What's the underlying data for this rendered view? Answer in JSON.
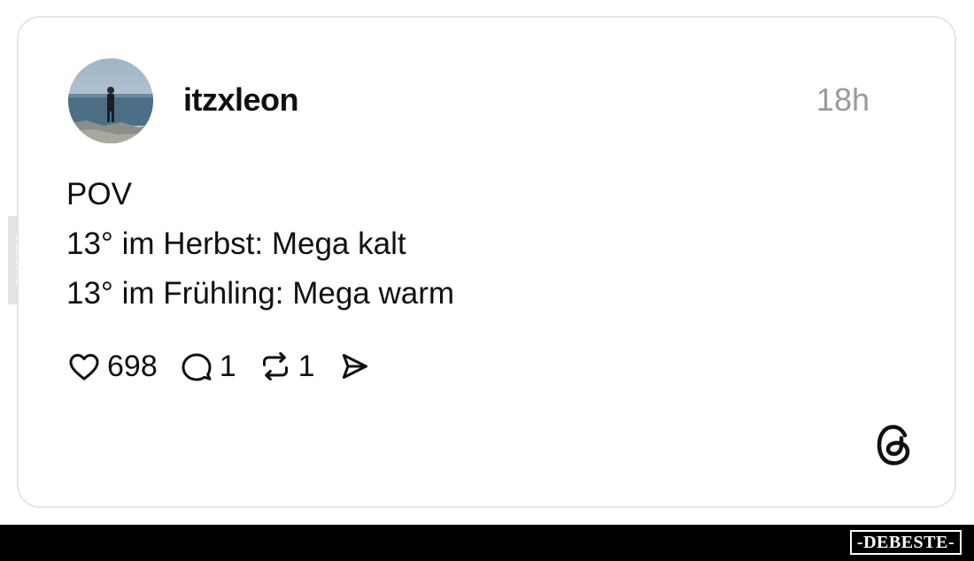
{
  "post": {
    "username": "itzxleon",
    "timestamp": "18h",
    "lines": [
      "POV",
      "13° im Herbst: Mega kalt",
      "13° im Frühling: Mega warm"
    ],
    "actions": {
      "likes": "698",
      "comments": "1",
      "reposts": "1"
    }
  },
  "icons": {
    "like": "heart-icon",
    "comment": "comment-bubble-icon",
    "repost": "repost-icon",
    "share": "send-icon",
    "brand": "threads-logo-icon"
  },
  "watermark": {
    "side": "DEBESTE",
    "footer": "-DEBESTE-"
  },
  "colors": {
    "text": "#101010",
    "muted": "#9a9a9a",
    "card_border": "#e6e6e6",
    "footer_bg": "#000000"
  }
}
